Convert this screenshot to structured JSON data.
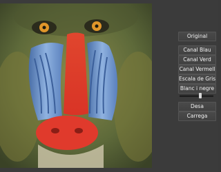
{
  "image": {
    "subject": "mandrill-image",
    "icon": "image"
  },
  "controls": {
    "original_label": "Original",
    "canal_blau_label": "Canal Blau",
    "canal_verd_label": "Canal Verd",
    "canal_vermell_label": "Canal Vermell",
    "escala_grisos_label": "Escala de Grisos",
    "blanc_negre_label": "Blanc i negre",
    "threshold_level": 0.62,
    "desa_label": "Desa",
    "carrega_label": "Carrega"
  }
}
